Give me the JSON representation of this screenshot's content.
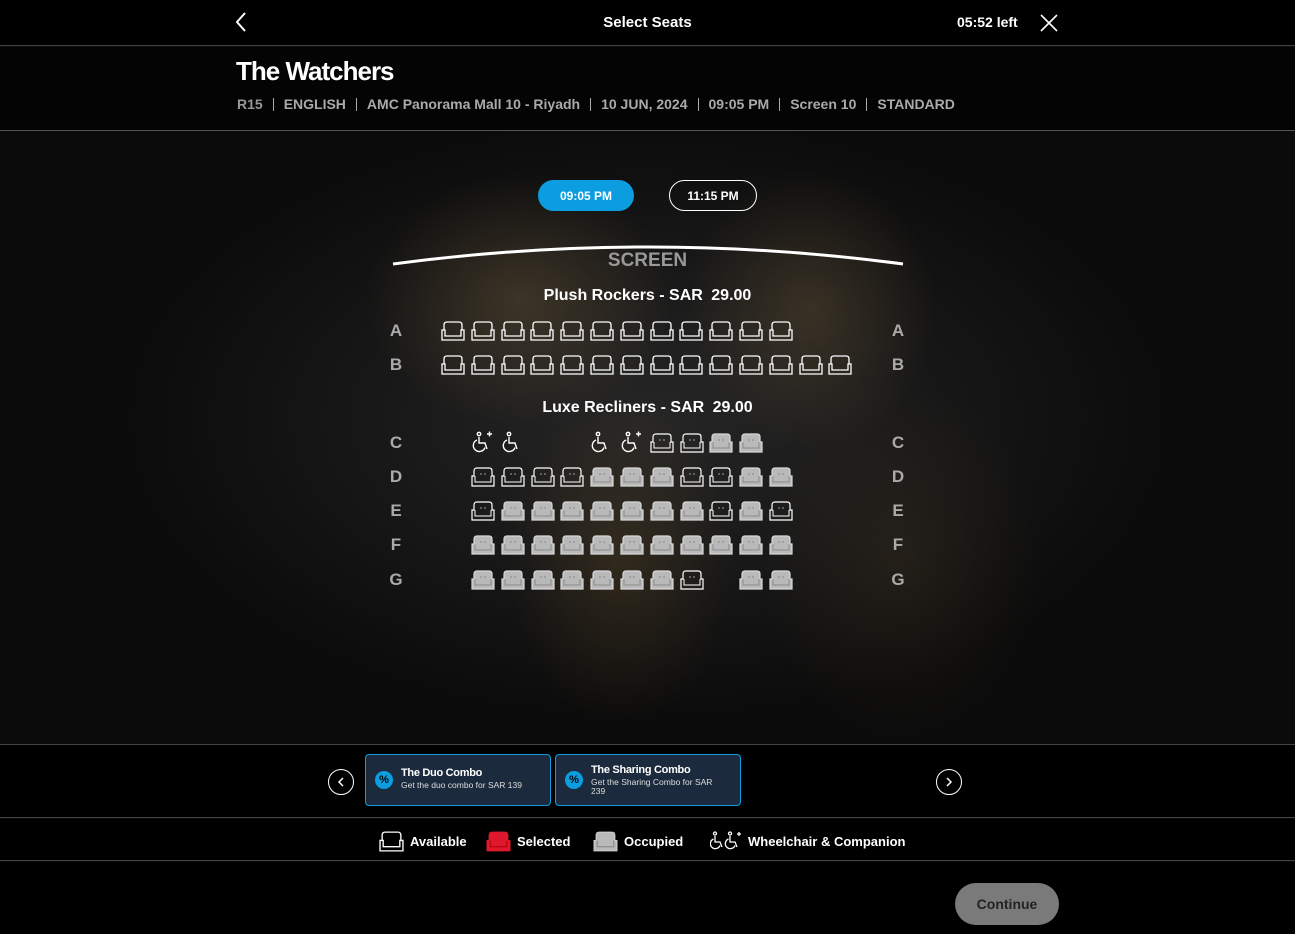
{
  "header": {
    "title": "Select Seats",
    "timer": "05:52 left"
  },
  "movie": {
    "title": "The Watchers",
    "meta": [
      "R15",
      "ENGLISH",
      "AMC Panorama Mall 10 - Riyadh",
      "10 JUN, 2024",
      "09:05 PM",
      "Screen 10",
      "STANDARD"
    ]
  },
  "showtimes": [
    {
      "label": "09:05 PM",
      "selected": true
    },
    {
      "label": "11:15 PM",
      "selected": false
    }
  ],
  "screen_label": "SCREEN",
  "sections": [
    {
      "name": "Plush Rockers -",
      "currency": "SAR",
      "price": "29.00"
    },
    {
      "name": "Luxe Recliners -",
      "currency": "SAR",
      "price": "29.00"
    }
  ],
  "rows": [
    "A",
    "B",
    "C",
    "D",
    "E",
    "F",
    "G"
  ],
  "seat_map": {
    "A": "AAAAAAAAAAAA",
    "B": "AAAAAAAAAAAAAA",
    "C": "WW  WWAAOO",
    "D": "AAAAOOOAAOO",
    "E": "AOOOOOOOAOA",
    "F": "OOOOOOOOOOO",
    "G": "OOOOOOOA OO"
  },
  "combos": [
    {
      "title": "The Duo Combo",
      "desc": "Get the duo combo for SAR 139"
    },
    {
      "title": "The Sharing Combo",
      "desc": "Get the Sharing Combo for SAR 239"
    }
  ],
  "legend": {
    "available": "Available",
    "selected": "Selected",
    "occupied": "Occupied",
    "wheelchair": "Wheelchair & Companion"
  },
  "colors": {
    "accent": "#0b9de0",
    "selected": "#e0182d",
    "occupied": "#b9b9b9",
    "available": "#ffffff"
  },
  "continue_label": "Continue"
}
